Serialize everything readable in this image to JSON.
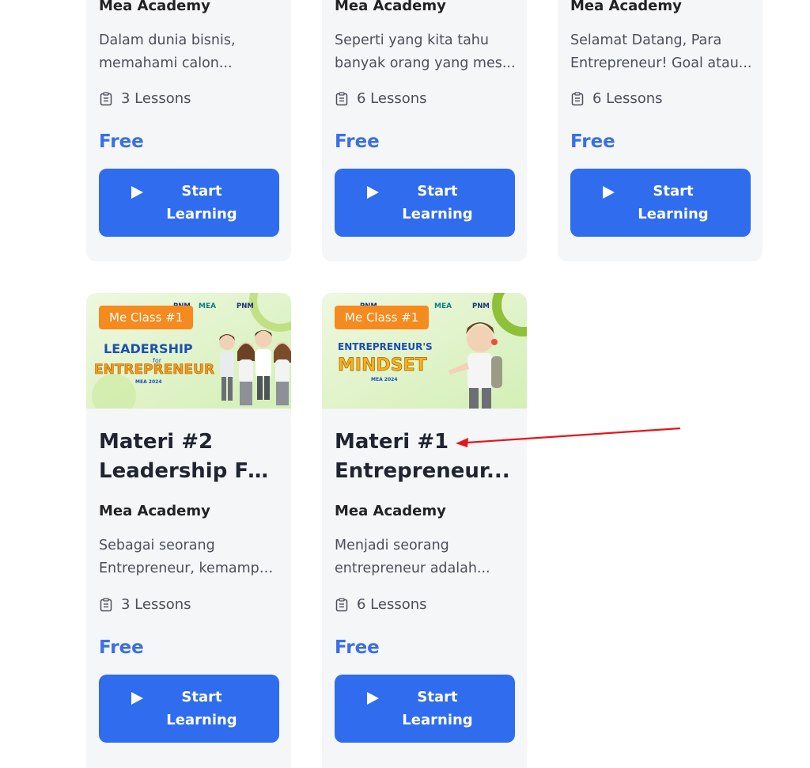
{
  "courses_top": [
    {
      "author": "Mea Academy",
      "desc": [
        "Dalam dunia bisnis,",
        "memahami calon..."
      ],
      "lessons": "3 Lessons",
      "price": "Free",
      "btn": [
        "Start",
        "Learning"
      ]
    },
    {
      "author": "Mea Academy",
      "desc": [
        "Seperti yang kita tahu",
        "banyak orang yang mes..."
      ],
      "lessons": "6 Lessons",
      "price": "Free",
      "btn": [
        "Start",
        "Learning"
      ]
    },
    {
      "author": "Mea Academy",
      "desc": [
        "Selamat Datang, Para",
        "Entrepreneur! Goal atau..."
      ],
      "lessons": "6 Lessons",
      "price": "Free",
      "btn": [
        "Start",
        "Learning"
      ]
    }
  ],
  "courses_bottom": [
    {
      "badge": "Me Class #1",
      "thumb": {
        "logos": [
          "PNM",
          "MEA",
          "PNM"
        ],
        "line1": "LEADERSHIP",
        "small": "for",
        "line2": "ENTREPRENEUR",
        "year": "MEA 2024"
      },
      "title": [
        "Materi #2",
        "Leadership For..."
      ],
      "author": "Mea Academy",
      "desc": [
        "Sebagai seorang",
        "Entrepreneur, kemampu..."
      ],
      "lessons": "3 Lessons",
      "price": "Free",
      "btn": [
        "Start",
        "Learning"
      ]
    },
    {
      "badge": "Me Class #1",
      "thumb": {
        "logos": [
          "PNM",
          "MEA",
          "PNM"
        ],
        "line1": "ENTREPRENEUR'S",
        "line2": "MINDSET",
        "year": "MEA 2024"
      },
      "title": [
        "Materi #1",
        "Entrepreneur..."
      ],
      "author": "Mea Academy",
      "desc": [
        "Menjadi seorang",
        "entrepreneur adalah..."
      ],
      "lessons": "6 Lessons",
      "price": "Free",
      "btn": [
        "Start",
        "Learning"
      ]
    }
  ],
  "colors": {
    "accent": "#2f6cee",
    "price": "#3a6fe6",
    "badge": "#f58a1f",
    "card": "#f5f6f8",
    "annotation": "#e8141b"
  },
  "icons": {
    "lessons": "clipboard-list-icon",
    "button": "play-icon"
  }
}
